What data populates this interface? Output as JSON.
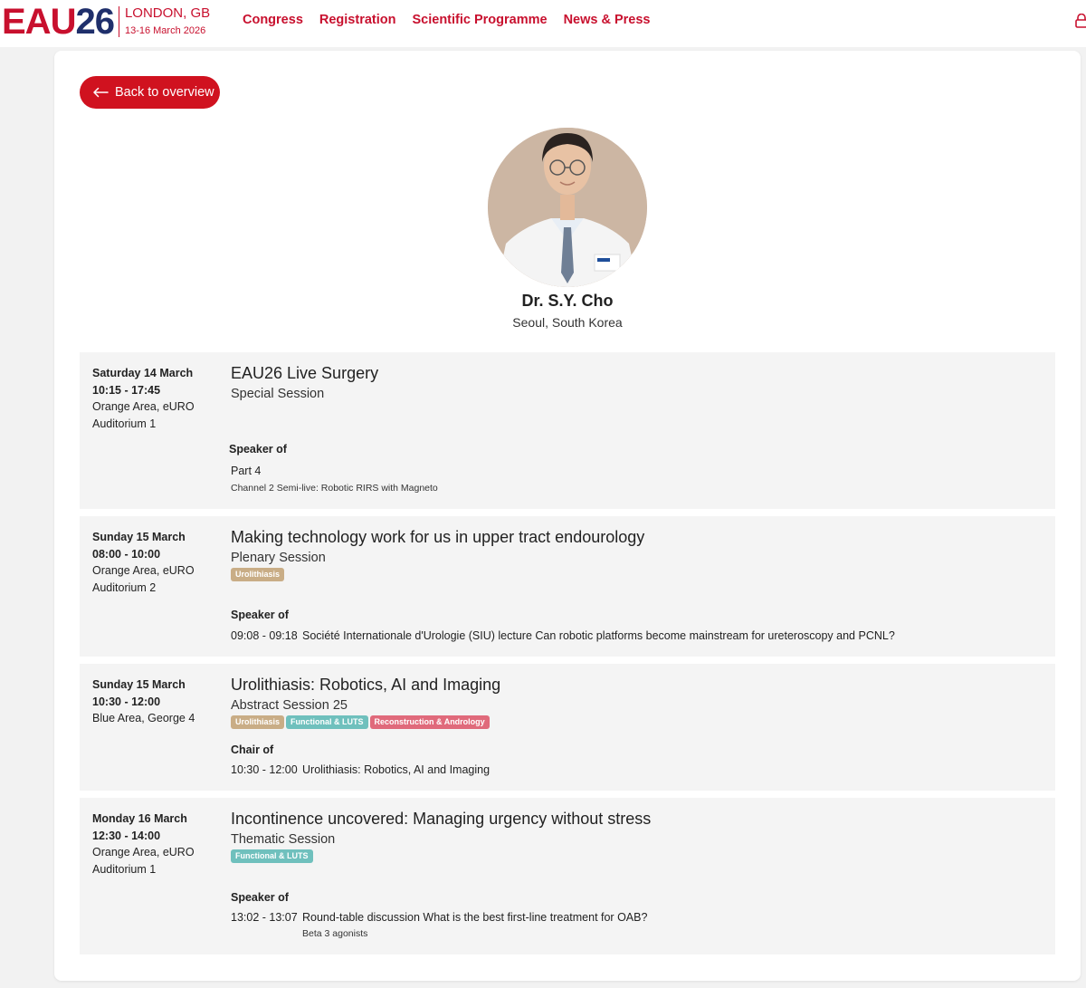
{
  "header": {
    "logo_eau": "EAU",
    "logo_num": "26",
    "logo_city": "LONDON, GB",
    "logo_dates": "13-16 March 2026",
    "nav": [
      "Congress",
      "Registration",
      "Scientific Programme",
      "News & Press"
    ],
    "account_icon": "lock-icon"
  },
  "colors": {
    "brand_red": "#c8102e",
    "brand_navy": "#1f2f6b",
    "tag_urolithiasis": "#c9ad86",
    "tag_functional": "#6fc0bd",
    "tag_reconstruction": "#e06a7b"
  },
  "back_button": {
    "label": "Back to overview",
    "icon": "arrow-left-icon"
  },
  "speaker": {
    "name": "Dr. S.Y. Cho",
    "location": "Seoul, South Korea"
  },
  "sessions": [
    {
      "day": "Saturday 14 March",
      "time": "10:15 - 17:45",
      "location_line1": "Orange Area, eURO",
      "location_line2": "Auditorium 1",
      "title": "EAU26 Live Surgery",
      "type": "Special Session",
      "tags": [],
      "role": "Speaker of",
      "talk_time": "",
      "talk_title": "Part 4",
      "talk_subtitle": "Channel 2 Semi-live: Robotic RIRS with Magneto"
    },
    {
      "day": "Sunday 15 March",
      "time": "08:00 - 10:00",
      "location_line1": "Orange Area, eURO",
      "location_line2": "Auditorium 2",
      "title": "Making technology work for us in upper tract endourology",
      "type": "Plenary Session",
      "tags": [
        "Urolithiasis"
      ],
      "role": "Speaker of",
      "talk_time": "09:08 - 09:18",
      "talk_title": "Société Internationale d'Urologie (SIU) lecture Can robotic platforms become mainstream for ureteroscopy and PCNL?",
      "talk_subtitle": ""
    },
    {
      "day": "Sunday 15 March",
      "time": "10:30 - 12:00",
      "location_line1": "Blue Area, George 4",
      "location_line2": "",
      "title": "Urolithiasis: Robotics, AI and Imaging",
      "type": "Abstract Session 25",
      "tags": [
        "Urolithiasis",
        "Functional & LUTS",
        "Reconstruction & Andrology"
      ],
      "role": "Chair of",
      "talk_time": "10:30 - 12:00",
      "talk_title": "Urolithiasis: Robotics, AI and Imaging",
      "talk_subtitle": ""
    },
    {
      "day": "Monday 16 March",
      "time": "12:30 - 14:00",
      "location_line1": "Orange Area, eURO",
      "location_line2": "Auditorium 1",
      "title": "Incontinence uncovered: Managing urgency without stress",
      "type": "Thematic Session",
      "tags": [
        "Functional & LUTS"
      ],
      "role": "Speaker of",
      "talk_time": "13:02 - 13:07",
      "talk_title": "Round-table discussion What is the best first-line treatment for OAB?",
      "talk_subtitle": "Beta 3 agonists"
    }
  ]
}
